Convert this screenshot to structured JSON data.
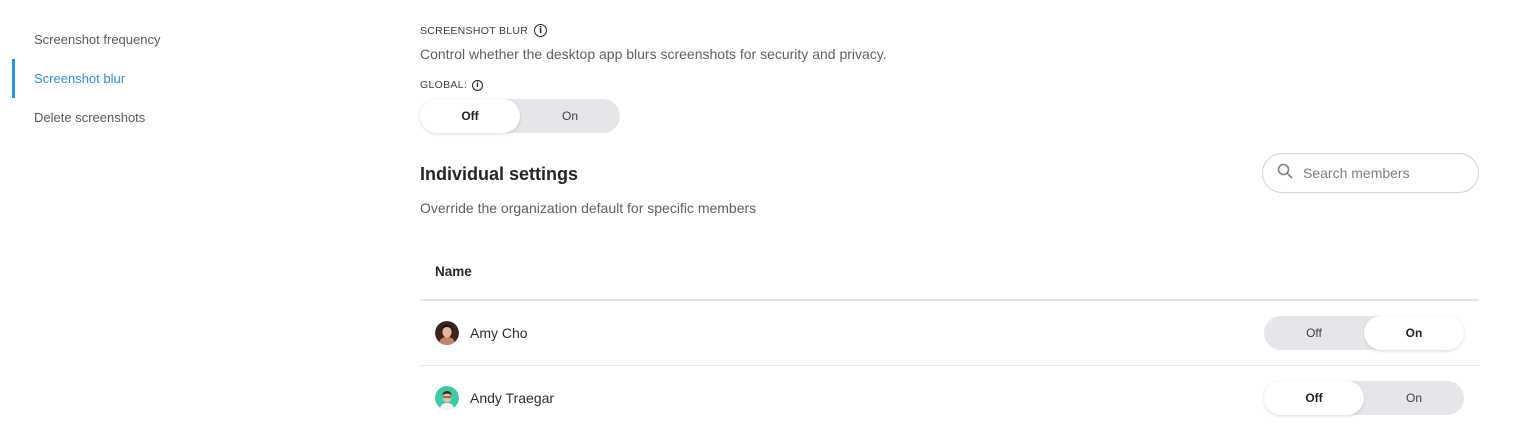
{
  "sidebar": {
    "items": [
      {
        "label": "Screenshot frequency",
        "active": false
      },
      {
        "label": "Screenshot blur",
        "active": true
      },
      {
        "label": "Delete screenshots",
        "active": false
      }
    ]
  },
  "section": {
    "label": "SCREENSHOT BLUR",
    "description": "Control whether the desktop app blurs screenshots for security and privacy.",
    "global_label": "GLOBAL:",
    "global_toggle": {
      "off_label": "Off",
      "on_label": "On",
      "selected": "Off"
    }
  },
  "individual": {
    "title": "Individual settings",
    "description": "Override the organization default for specific members",
    "search": {
      "placeholder": "Search members",
      "value": ""
    },
    "table": {
      "column_name": "Name",
      "rows": [
        {
          "name": "Amy Cho",
          "off_label": "Off",
          "on_label": "On",
          "selected": "On"
        },
        {
          "name": "Andy Traegar",
          "off_label": "Off",
          "on_label": "On",
          "selected": "Off"
        }
      ]
    }
  },
  "colors": {
    "accent": "#2f8fe5",
    "toggle_track": "#e4e6ea"
  }
}
